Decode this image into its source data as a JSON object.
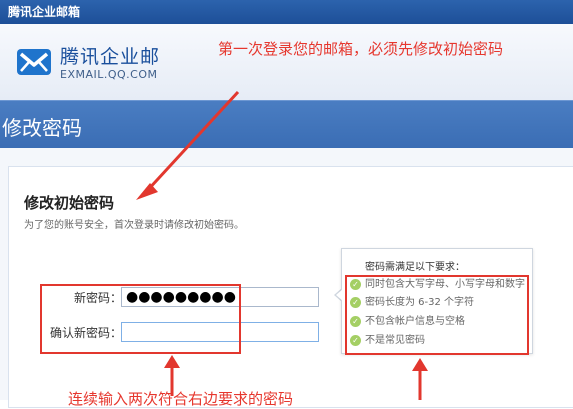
{
  "window": {
    "title": "腾讯企业邮箱"
  },
  "logo": {
    "name_cn": "腾讯企业邮",
    "name_en": "EXMAIL.QQ.COM"
  },
  "annotations": {
    "top": "第一次登录您的邮箱，必须先修改初始密码",
    "bottom": "连续输入两次符合右边要求的密码"
  },
  "page": {
    "title": "修改密码"
  },
  "form": {
    "section_title": "修改初始密码",
    "section_desc": "为了您的账号安全，首次登录时请修改初始密码。",
    "new_password": {
      "label": "新密码：",
      "value": "●●●●●●●●●"
    },
    "confirm_password": {
      "label": "确认新密码：",
      "value": ""
    }
  },
  "requirements": {
    "title": "密码需满足以下要求：",
    "items": [
      "同时包含大写字母、小写字母和数字",
      "密码长度为 6-32 个字符",
      "不包含帐户信息与空格",
      "不是常见密码"
    ]
  },
  "colors": {
    "titlebar": "#1d4f98",
    "page_band": "#4a7dc2",
    "annotation_red": "#e2372e",
    "check_green": "#a4cf64"
  }
}
